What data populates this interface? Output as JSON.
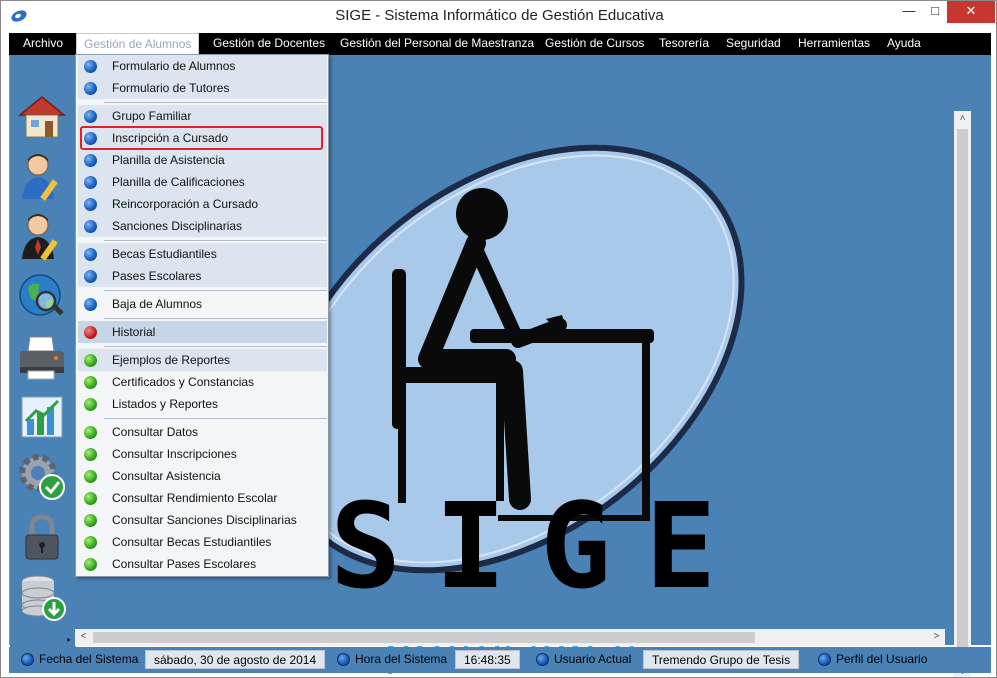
{
  "window": {
    "title": "SIGE - Sistema Informático de Gestión Educativa"
  },
  "menubar": {
    "items": [
      {
        "label": "Archivo"
      },
      {
        "label": "Gestión de Alumnos"
      },
      {
        "label": "Gestión de Docentes"
      },
      {
        "label": "Gestión del Personal de Maestranza"
      },
      {
        "label": "Gestión de Cursos"
      },
      {
        "label": "Tesorería"
      },
      {
        "label": "Seguridad"
      },
      {
        "label": "Herramientas"
      },
      {
        "label": "Ayuda"
      }
    ],
    "open_menu": "Gestión de Alumnos"
  },
  "dropdown": {
    "items": [
      {
        "label": "Formulario de Alumnos",
        "dot": "blue"
      },
      {
        "label": "Formulario de Tutores",
        "dot": "blue"
      },
      {
        "label": "Grupo Familiar",
        "dot": "blue"
      },
      {
        "label": "Inscripción a Cursado",
        "dot": "blue"
      },
      {
        "label": "Planilla de Asistencia",
        "dot": "blue"
      },
      {
        "label": "Planilla de Calificaciones",
        "dot": "blue"
      },
      {
        "label": "Reincorporación a Cursado",
        "dot": "blue"
      },
      {
        "label": "Sanciones Disciplinarias",
        "dot": "blue"
      },
      {
        "label": "Becas Estudiantiles",
        "dot": "blue"
      },
      {
        "label": "Pases Escolares",
        "dot": "blue"
      },
      {
        "label": "Baja de Alumnos",
        "dot": "blue"
      },
      {
        "label": "Historial",
        "dot": "red"
      },
      {
        "label": "Ejemplos de Reportes",
        "dot": "green"
      },
      {
        "label": "Certificados y Constancias",
        "dot": "green"
      },
      {
        "label": "Listados y Reportes",
        "dot": "green"
      },
      {
        "label": "Consultar Datos",
        "dot": "green"
      },
      {
        "label": "Consultar Inscripciones",
        "dot": "green"
      },
      {
        "label": "Consultar Asistencia",
        "dot": "green"
      },
      {
        "label": "Consultar Rendimiento Escolar",
        "dot": "green"
      },
      {
        "label": "Consultar Sanciones Disciplinarias",
        "dot": "green"
      },
      {
        "label": "Consultar Becas Estudiantiles",
        "dot": "green"
      },
      {
        "label": "Consultar Pases Escolares",
        "dot": "green"
      }
    ],
    "focused_item": "Inscripción a Cursado"
  },
  "sidebar": {
    "icons": [
      "home-icon",
      "student-edit-icon",
      "teacher-icon",
      "globe-search-icon",
      "printer-icon",
      "chart-icon",
      "settings-check-icon",
      "lock-icon",
      "database-download-icon"
    ]
  },
  "logo": {
    "title": "SIGE",
    "subtitle": "profesional"
  },
  "statusbar": {
    "fecha_label": "Fecha del Sistema",
    "fecha_value": "sábado, 30 de agosto de 2014",
    "hora_label": "Hora del Sistema",
    "hora_value": "16:48:35",
    "usuario_label": "Usuario Actual",
    "usuario_value": "Tremendo Grupo de Tesis",
    "perfil_label": "Perfil del Usuario"
  },
  "colors": {
    "background": "#4a82b6",
    "menubar": "#000000",
    "focus_outline": "#e0202a",
    "logo_accent": "#3eb0e8"
  }
}
